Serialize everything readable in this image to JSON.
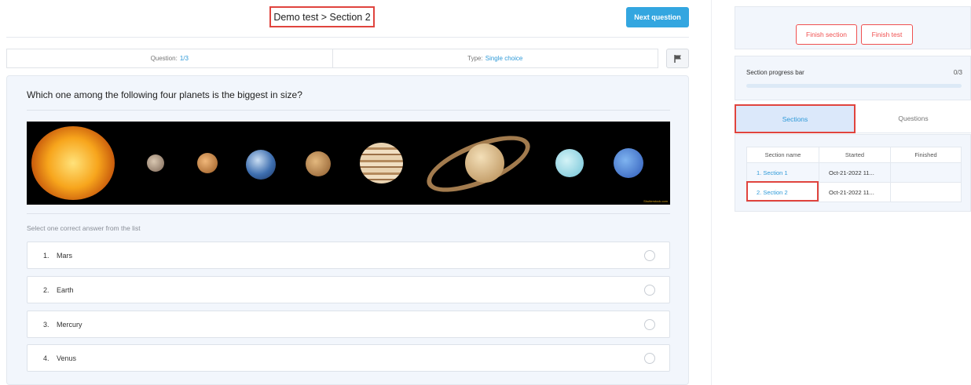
{
  "header": {
    "title": "Demo test > Section 2",
    "next_button": "Next question"
  },
  "info": {
    "question_label": "Question:",
    "question_value": "1/3",
    "type_label": "Type:",
    "type_value": "Single choice"
  },
  "question": {
    "text": "Which one among the following four planets is the biggest in size?",
    "instruction": "Select one correct answer from the list",
    "image_credit": "Shutterstock.com",
    "answers": [
      {
        "num": "1.",
        "label": "Mars"
      },
      {
        "num": "2.",
        "label": "Earth"
      },
      {
        "num": "3.",
        "label": "Mercury"
      },
      {
        "num": "4.",
        "label": "Venus"
      }
    ]
  },
  "sidebar": {
    "finish_section": "Finish section",
    "finish_test": "Finish test",
    "progress_label": "Section progress bar",
    "progress_count": "0/3",
    "progress_fraction": 0,
    "tabs": {
      "sections": "Sections",
      "questions": "Questions"
    },
    "table": {
      "headers": [
        "Section name",
        "Started",
        "Finished"
      ],
      "rows": [
        {
          "name": "1. Section 1",
          "started": "Oct-21-2022 11...",
          "finished": ""
        },
        {
          "name": "2. Section 2",
          "started": "Oct-21-2022 11...",
          "finished": ""
        }
      ]
    }
  },
  "colors": {
    "accent": "#33a6e0",
    "danger": "#f05050",
    "highlight": "#e0443e"
  },
  "icons": {
    "flag": "flag-icon",
    "radio": "radio-icon"
  }
}
